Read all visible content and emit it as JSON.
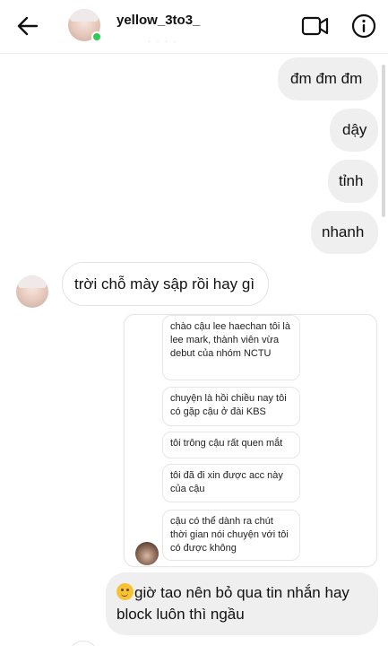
{
  "header": {
    "username": "yellow_3to3_",
    "subtext": "· · ·   ·",
    "online": true
  },
  "messages_outgoing": [
    {
      "text": "đm đm đm"
    },
    {
      "text": "dậy"
    },
    {
      "text": "tỉnh"
    },
    {
      "text": "nhanh"
    }
  ],
  "message_incoming": {
    "text": "trời chỗ mày sập rồi hay gì"
  },
  "shared_conversation": {
    "messages": [
      "chào cậu lee haechan tôi là lee mark, thành viên vừa debut của nhóm NCTU",
      "chuyện là hồi chiều nay tôi có gặp cậu ở đài KBS",
      "tôi trông cậu rất quen mắt",
      "tôi đã đi xin được acc này của cậu",
      "cậu có thể dành ra chút thời gian nói chuyện với tôi có được không"
    ]
  },
  "last_message": {
    "emoji": "slightly-smiling-face",
    "text": "giờ tao nên bỏ qua tin nhắn hay block luôn thì ngầu"
  },
  "colors": {
    "outgoing_bubble": "#efefef",
    "online": "#2ecc52",
    "border": "#e3e3e3"
  }
}
